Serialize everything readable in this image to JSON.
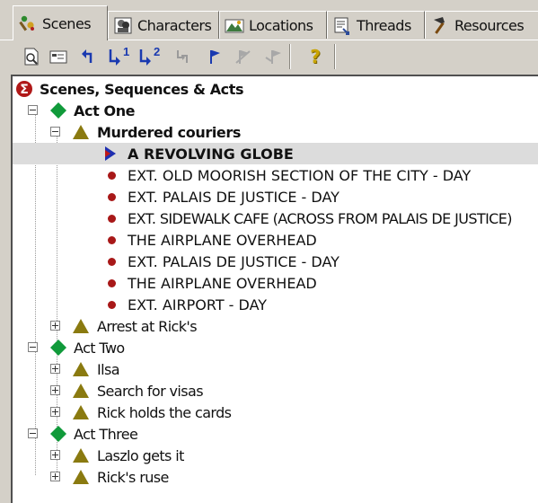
{
  "tabs": [
    {
      "label": "Scenes",
      "icon": "scenes-icon",
      "active": true
    },
    {
      "label": "Characters",
      "icon": "characters-icon",
      "active": false
    },
    {
      "label": "Locations",
      "icon": "locations-icon",
      "active": false
    },
    {
      "label": "Threads",
      "icon": "threads-icon",
      "active": false
    },
    {
      "label": "Resources",
      "icon": "resources-icon",
      "active": false
    }
  ],
  "toolbar": {
    "buttons": [
      "preview-icon",
      "properties-icon",
      "back-arrow-icon",
      "level-1-icon",
      "level-2-icon",
      "move-icon",
      "flag-icon",
      "flag-disabled-icon",
      "flag-disabled-2-icon",
      "help-icon"
    ],
    "level1_label": "1",
    "level2_label": "2",
    "help_label": "?"
  },
  "tree": {
    "root": {
      "label": "Scenes, Sequences & Acts",
      "icon": "sigma-icon",
      "icon_char": "Σ"
    },
    "act_one": {
      "label": "Act One",
      "expanded": true
    },
    "seq_murdered": {
      "label": "Murdered couriers",
      "expanded": true
    },
    "scenes_murdered": [
      "A REVOLVING GLOBE",
      "EXT. OLD MOORISH SECTION OF THE CITY - DAY",
      "EXT. PALAIS DE JUSTICE - DAY",
      "EXT. SIDEWALK CAFE (ACROSS FROM PALAIS DE JUSTICE)",
      "THE AIRPLANE OVERHEAD",
      "EXT. PALAIS DE JUSTICE - DAY",
      "THE AIRPLANE OVERHEAD",
      "EXT. AIRPORT - DAY"
    ],
    "seq_arrest": {
      "label": "Arrest at Rick's",
      "expanded": false
    },
    "act_two": {
      "label": "Act Two",
      "expanded": true
    },
    "seq_ilsa": {
      "label": "Ilsa",
      "expanded": false
    },
    "seq_visas": {
      "label": "Search for visas",
      "expanded": false
    },
    "seq_cards": {
      "label": "Rick holds the cards",
      "expanded": false
    },
    "act_three": {
      "label": "Act Three",
      "expanded": true
    },
    "seq_laszlo": {
      "label": "Laszlo gets it",
      "expanded": false
    },
    "seq_ruse": {
      "label": "Rick's ruse",
      "expanded": false
    },
    "selected_scene": "A REVOLVING GLOBE"
  },
  "colors": {
    "act_diamond": "#109a3a",
    "sequence_triangle": "#8a7a10",
    "scene_dot": "#a81818",
    "selected_flag": "#1f2fb0",
    "root_icon": "#b01818",
    "help_icon": "#c9a400"
  }
}
